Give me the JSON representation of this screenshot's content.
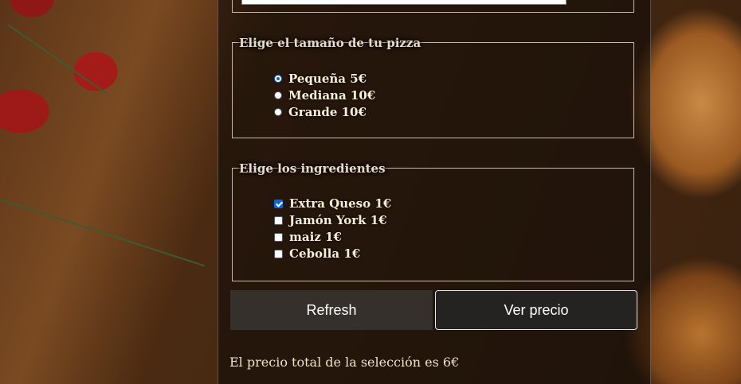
{
  "size_group": {
    "legend": "Elige el tamaño de tu pizza",
    "options": [
      {
        "label": "Pequeña 5€",
        "checked": true
      },
      {
        "label": "Mediana 10€",
        "checked": false
      },
      {
        "label": "Grande 10€",
        "checked": false
      }
    ]
  },
  "ingredients_group": {
    "legend": "Elige los ingredientes",
    "options": [
      {
        "label": "Extra Queso 1€",
        "checked": true
      },
      {
        "label": "Jamón York 1€",
        "checked": false
      },
      {
        "label": "maiz 1€",
        "checked": false
      },
      {
        "label": "Cebolla 1€",
        "checked": false
      }
    ]
  },
  "buttons": {
    "refresh_label": "Refresh",
    "price_label": "Ver precio"
  },
  "result": {
    "total_text": "El precio total de la selección es 6€"
  },
  "colors": {
    "accent": "#0a66d8",
    "text": "#fff1d6"
  }
}
